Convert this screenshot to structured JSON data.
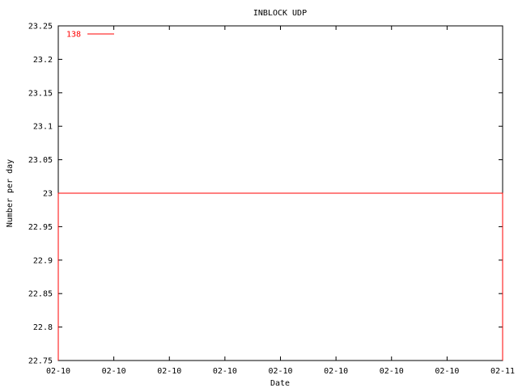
{
  "chart_data": {
    "type": "line",
    "title": "INBLOCK UDP",
    "xlabel": "Date",
    "ylabel": "Number per day",
    "ylim": [
      22.75,
      23.25
    ],
    "yticks": [
      22.75,
      22.8,
      22.85,
      22.9,
      22.95,
      23,
      23.05,
      23.1,
      23.15,
      23.2,
      23.25
    ],
    "ytick_labels": [
      "22.75",
      "22.8",
      "22.85",
      "22.9",
      "22.95",
      "23",
      "23.05",
      "23.1",
      "23.15",
      "23.2",
      "23.25"
    ],
    "xtick_labels": [
      "02-10",
      "02-10",
      "02-10",
      "02-10",
      "02-10",
      "02-10",
      "02-10",
      "02-10",
      "02-11"
    ],
    "grid": false,
    "legend_position": "top-left",
    "series": [
      {
        "name": "138",
        "color": "#ff0000",
        "x": [
          0,
          0,
          8,
          8
        ],
        "y": [
          22.75,
          23,
          23,
          22.75
        ]
      }
    ]
  }
}
